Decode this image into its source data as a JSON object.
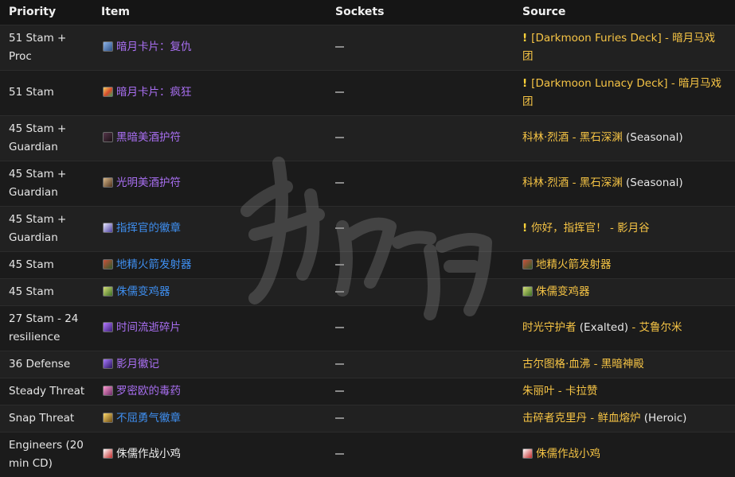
{
  "headers": {
    "priority": "Priority",
    "item": "Item",
    "sockets": "Sockets",
    "source": "Source"
  },
  "socket_placeholder": "—",
  "rows": [
    {
      "priority": "51 Stam + Proc",
      "item": "暗月卡片：复仇",
      "item_quality": "epic",
      "item_icon": "blue",
      "source": {
        "quest": true,
        "link": "[Darkmoon Furies Deck] - 暗月马戏团",
        "suffix": ""
      }
    },
    {
      "priority": "51 Stam",
      "item": "暗月卡片：疯狂",
      "item_quality": "epic",
      "item_icon": "multi",
      "source": {
        "quest": true,
        "link": "[Darkmoon Lunacy Deck] - 暗月马戏团",
        "suffix": ""
      }
    },
    {
      "priority": "45 Stam + Guardian",
      "item": "黑暗美酒护符",
      "item_quality": "epic",
      "item_icon": "dark",
      "source": {
        "quest": false,
        "link": "科林·烈酒 - 黑石深渊",
        "suffix": " (Seasonal)"
      }
    },
    {
      "priority": "45 Stam + Guardian",
      "item": "光明美酒护符",
      "item_quality": "epic",
      "item_icon": "brown",
      "source": {
        "quest": false,
        "link": "科林·烈酒 - 黑石深渊",
        "suffix": " (Seasonal)"
      }
    },
    {
      "priority": "45 Stam + Guardian",
      "item": "指挥官的徽章",
      "item_quality": "rare",
      "item_icon": "shield",
      "source": {
        "quest": true,
        "link": "你好，指挥官！ - 影月谷",
        "suffix": ""
      }
    },
    {
      "priority": "45 Stam",
      "item": "地精火箭发射器",
      "item_quality": "rare",
      "item_icon": "gear",
      "source": {
        "quest": false,
        "icon": "gear",
        "link": "地精火箭发射器",
        "suffix": ""
      }
    },
    {
      "priority": "45 Stam",
      "item": "侏儒变鸡器",
      "item_quality": "rare",
      "item_icon": "green",
      "source": {
        "quest": false,
        "icon": "green",
        "link": "侏儒变鸡器",
        "suffix": ""
      }
    },
    {
      "priority": "27 Stam - 24 resilience",
      "item": "时间流逝碎片",
      "item_quality": "epic",
      "item_icon": "violet",
      "source": {
        "quest": false,
        "link": "时光守护者",
        "suffix": " (Exalted) - 艾鲁尔米",
        "suffix_color": "mixed"
      }
    },
    {
      "priority": "36 Defense",
      "item": "影月徽记",
      "item_quality": "epic",
      "item_icon": "purple",
      "source": {
        "quest": false,
        "link": "古尔图格·血沸 - 黑暗神殿",
        "suffix": ""
      }
    },
    {
      "priority": "Steady Threat",
      "item": "罗密欧的毒药",
      "item_quality": "epic",
      "item_icon": "pink",
      "source": {
        "quest": false,
        "link": "朱丽叶 - 卡拉赞",
        "suffix": ""
      }
    },
    {
      "priority": "Snap Threat",
      "item": "不屈勇气徽章",
      "item_quality": "rare",
      "item_icon": "gold",
      "source": {
        "quest": false,
        "link": "击碎者克里丹 - 鲜血熔炉",
        "suffix": " (Heroic)"
      }
    },
    {
      "priority": "Engineers (20 min CD)",
      "item": "侏儒作战小鸡",
      "item_quality": "common",
      "item_icon": "red",
      "source": {
        "quest": false,
        "icon": "red",
        "link": "侏儒作战小鸡",
        "suffix": ""
      }
    }
  ],
  "colors": {
    "epic": "#a96ff2",
    "rare": "#3f8ff0",
    "source_link": "#f6c445",
    "quest_marker": "#ffd23a"
  }
}
